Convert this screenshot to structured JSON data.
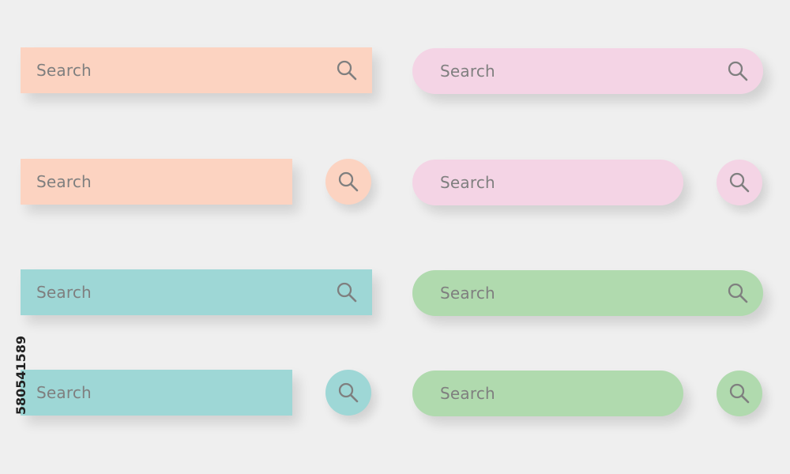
{
  "colors": {
    "peach": "#fcd3c1",
    "pink": "#f4d4e5",
    "teal": "#9ed7d6",
    "green": "#b0daae",
    "text": "#7f7f7f",
    "icon": "#7f7f7f"
  },
  "search": {
    "placeholder": "Search",
    "icon": "search-icon"
  },
  "stock_id": "580541589"
}
